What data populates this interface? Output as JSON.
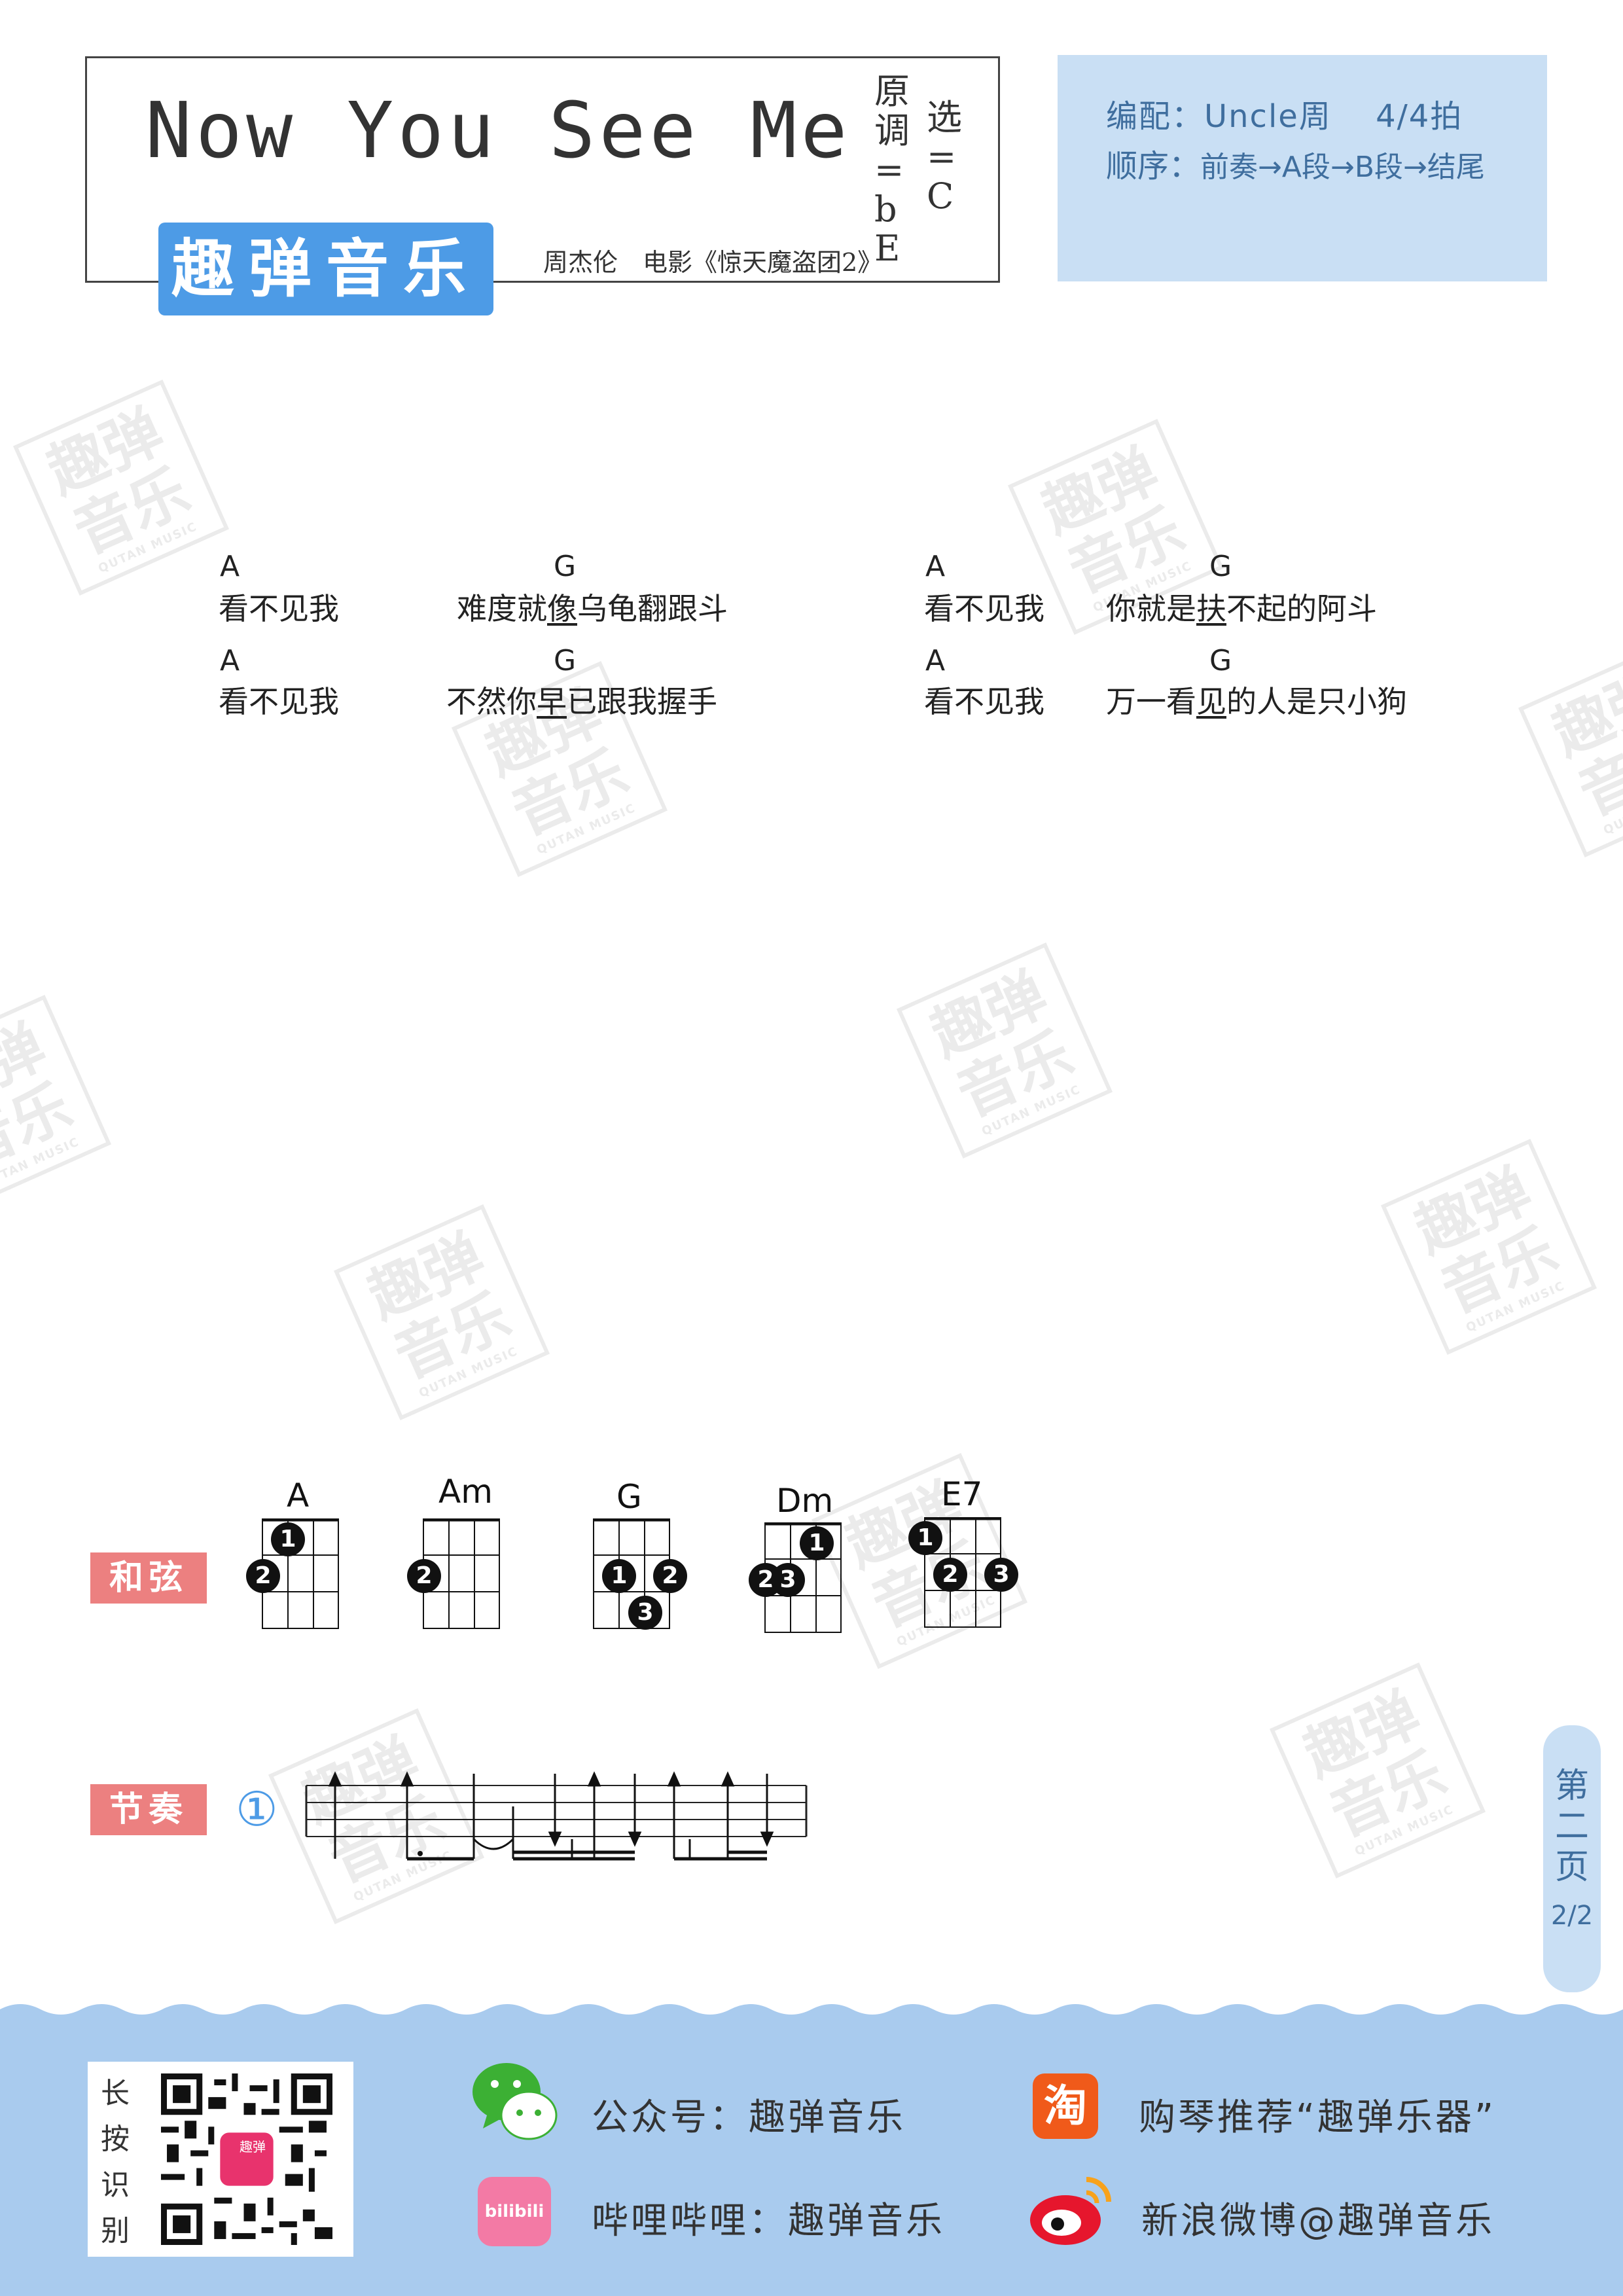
{
  "header": {
    "title": "Now You See Me",
    "key_original": "原调=bE",
    "key_selected": "选=C",
    "brand": "趣弹音乐",
    "artist_info": "周杰伦　电影《惊天魔盗团2》"
  },
  "info": {
    "arranger_line": "编配：Uncle周　 4/4拍",
    "order_label": "顺序：",
    "order_value": "前奏→A段→B段→结尾"
  },
  "lyrics": {
    "rows": [
      {
        "left": {
          "chord1": "A",
          "chord2": "G",
          "text1": "看不见我",
          "text2a": "难度就",
          "text2u": "像",
          "text2b": "乌龟翻跟斗"
        },
        "right": {
          "chord1": "A",
          "chord2": "G",
          "text1": "看不见我",
          "text2a": "你就是",
          "text2u": "扶",
          "text2b": "不起的阿斗"
        }
      },
      {
        "left": {
          "chord1": "A",
          "chord2": "G",
          "text1": "看不见我",
          "text2a": "不然你",
          "text2u": "早",
          "text2b": "已跟我握手"
        },
        "right": {
          "chord1": "A",
          "chord2": "G",
          "text1": "看不见我",
          "text2a": "万一看",
          "text2u": "见",
          "text2b": "的人是只小狗"
        }
      }
    ]
  },
  "chords_section": {
    "label": "和弦",
    "chords": [
      {
        "name": "A",
        "fingers": [
          "1",
          "2"
        ]
      },
      {
        "name": "Am",
        "fingers": [
          "2"
        ]
      },
      {
        "name": "G",
        "fingers": [
          "1",
          "2",
          "3"
        ]
      },
      {
        "name": "Dm",
        "fingers": [
          "1",
          "2",
          "3"
        ]
      },
      {
        "name": "E7",
        "fingers": [
          "1",
          "2",
          "3"
        ]
      }
    ]
  },
  "rhythm_section": {
    "label": "节奏",
    "pattern_number": "①"
  },
  "page_badge": {
    "label": "第二页",
    "number": "2/2"
  },
  "watermark": {
    "text_line1": "趣弹",
    "text_line2": "音乐",
    "text_small": "QUTAN MUSIC"
  },
  "footer": {
    "qr_label": "长按识别",
    "qr_badge": "趣弹",
    "wechat": "公众号：趣弹音乐",
    "taobao_icon_text": "淘",
    "taobao": "购琴推荐“趣弹乐器”",
    "bilibili_icon_text": "bilibili",
    "bilibili": "哔哩哔哩：趣弹音乐",
    "weibo": "新浪微博@趣弹音乐"
  },
  "colors": {
    "brand_blue": "#4d9be6",
    "panel_blue": "#c9dff4",
    "footer_blue": "#a9cbee",
    "label_red": "#ec8080",
    "taobao_orange": "#f05a1a",
    "bilibili_pink": "#f37aa5",
    "weibo_red": "#e6162d",
    "wechat_green": "#3cb034"
  }
}
